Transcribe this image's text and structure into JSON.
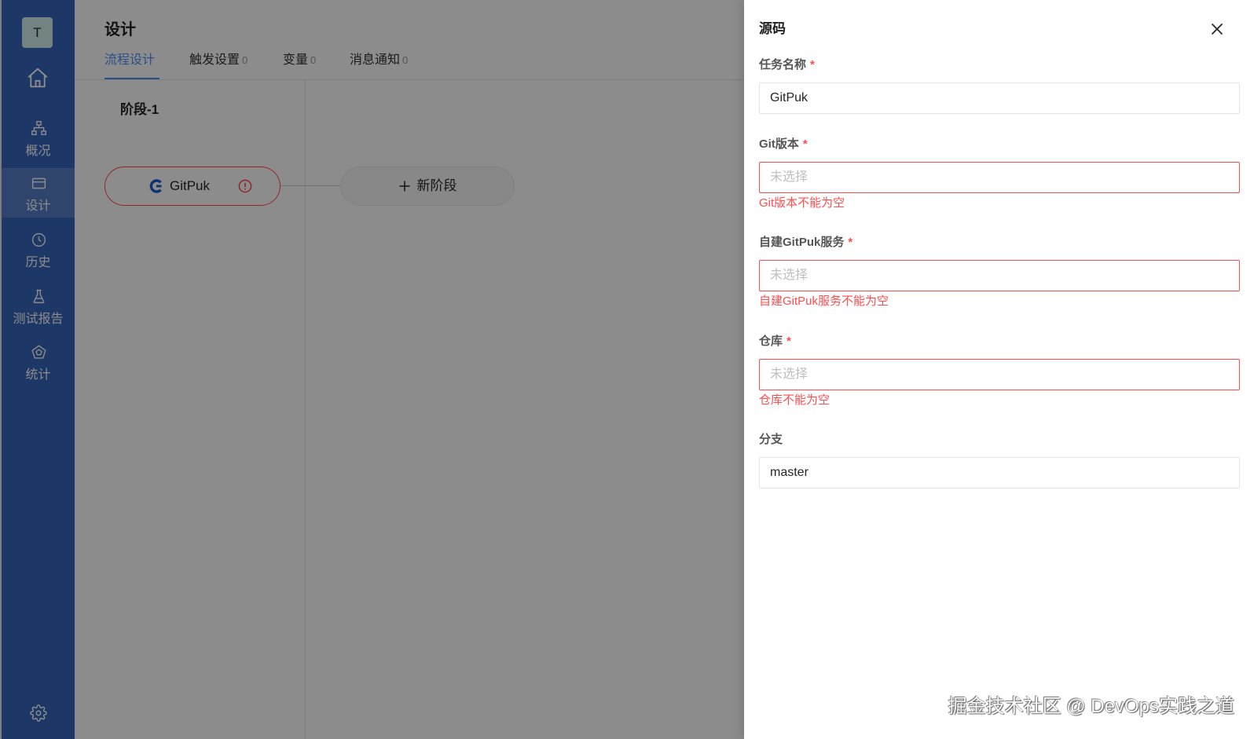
{
  "colors": {
    "accent": "#4f8ff7",
    "error": "#ff4d4f",
    "sidebar": "#3664bc",
    "mask": "rgba(0,0,0,0.45)"
  },
  "sidebar": {
    "avatar": "T",
    "home_icon": "home-icon",
    "items": [
      {
        "label": "概况",
        "icon": "sitemap-icon",
        "active": false
      },
      {
        "label": "设计",
        "icon": "card-icon",
        "active": true
      },
      {
        "label": "历史",
        "icon": "clock-icon",
        "active": false
      },
      {
        "label": "测试报告",
        "icon": "flask-icon",
        "active": false
      },
      {
        "label": "统计",
        "icon": "pentagon-icon",
        "active": false
      }
    ],
    "settings_icon": "gear-icon"
  },
  "header": {
    "title": "设计",
    "tabs": [
      {
        "label": "流程设计",
        "active": true
      },
      {
        "label": "触发设置",
        "count": "0"
      },
      {
        "label": "变量",
        "count": "0"
      },
      {
        "label": "消息通知",
        "count": "0"
      }
    ]
  },
  "pipeline": {
    "stage_title": "阶段-1",
    "task": {
      "name": "GitPuk",
      "icon": "gitpuk-logo-icon",
      "status": "error",
      "status_icon": "exclamation-circle-icon"
    },
    "add_stage": {
      "label": "新阶段",
      "icon": "plus-icon"
    }
  },
  "drawer": {
    "title": "源码",
    "close_icon": "close-icon",
    "required_mark": "*",
    "fields": [
      {
        "label": "任务名称",
        "required": true,
        "value": "GitPuk",
        "placeholder": "",
        "error": ""
      },
      {
        "label": "Git版本",
        "required": true,
        "value": "",
        "placeholder": "未选择",
        "error": "Git版本不能为空"
      },
      {
        "label": "自建GitPuk服务",
        "required": true,
        "value": "",
        "placeholder": "未选择",
        "error": "自建GitPuk服务不能为空"
      },
      {
        "label": "仓库",
        "required": true,
        "value": "",
        "placeholder": "未选择",
        "error": "仓库不能为空"
      },
      {
        "label": "分支",
        "required": false,
        "value": "master",
        "placeholder": "",
        "error": ""
      }
    ]
  },
  "watermark": "掘金技术社区 @ DevOps实践之道"
}
